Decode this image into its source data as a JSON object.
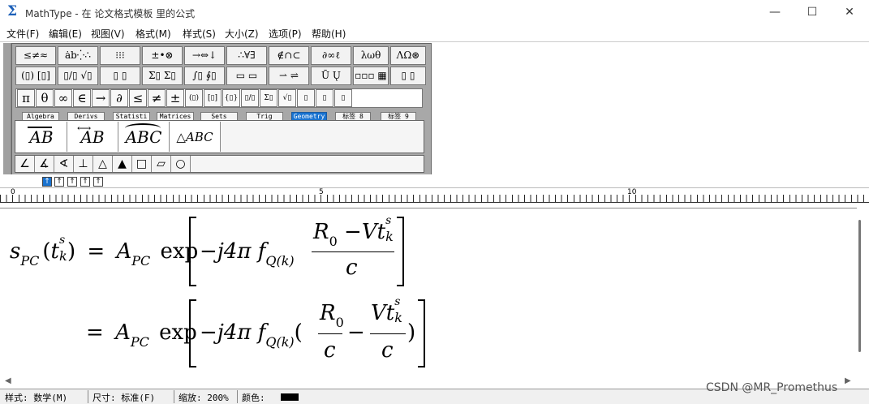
{
  "window": {
    "title": "MathType - 在 论文格式模板 里的公式",
    "min_glyph": "—",
    "max_glyph": "☐",
    "close_glyph": "✕"
  },
  "menu": [
    "文件(F)",
    "编辑(E)",
    "视图(V)",
    "格式(M)",
    "样式(S)",
    "大小(Z)",
    "选项(P)",
    "帮助(H)"
  ],
  "palette": {
    "row1": [
      "≤≠≈",
      "ȧb⁛∴",
      "⁝⁝⁝",
      "±•⊗",
      "→⇔↓",
      "∴∀∃",
      "∉∩⊂",
      "∂∞ℓ",
      "λωθ",
      "ΛΩ⊛"
    ],
    "row2": [
      "(▯) [▯]",
      "▯/▯ √▯",
      "▯ ▯",
      "Σ▯ Σ▯",
      "∫▯ ∮▯",
      "▭ ▭",
      "⇀ ⇌",
      "Ū Ų",
      "▫▫▫ ▦",
      "▯ ▯"
    ],
    "row3": [
      "π",
      "θ",
      "∞",
      "∈",
      "→",
      "∂",
      "≤",
      "≠",
      "±",
      "(▯)",
      "[▯]",
      "{▯}",
      "▯/▯",
      "Σ▯",
      "√▯",
      "▯",
      "▯",
      "▯"
    ],
    "tabs": [
      "Algebra",
      "Derivs",
      "Statisti",
      "Matrices",
      "Sets",
      "Trig",
      "Geometry",
      "标签 8",
      "标签 9"
    ],
    "active_tab": "Geometry",
    "geometry_templates": [
      "AB",
      "AB",
      "ABC",
      "△ABC"
    ],
    "shapes": [
      "∠",
      "∡",
      "∢",
      "⊥",
      "△",
      "▲",
      "□",
      "▱",
      "○"
    ]
  },
  "ruler": {
    "marks": [
      "0",
      "5",
      "10"
    ]
  },
  "equation": {
    "line1": {
      "lhs_s": "s",
      "lhs_sub": "PC",
      "lhs_t": "t",
      "lhs_t_sup": "s",
      "lhs_t_sub": "k",
      "eq": "=",
      "A": "A",
      "A_sub": "PC",
      "exp": "exp",
      "minus_j4": "−j4",
      "pi": "π",
      "f": "f",
      "f_sub": "Q(k)",
      "num_R": "R",
      "num_R_sub": "0",
      "num_minus": "−",
      "num_V": "Vt",
      "num_t_sup": "s",
      "num_t_sub": "k",
      "den": "c"
    },
    "line2": {
      "eq": "=",
      "A": "A",
      "A_sub": "PC",
      "exp": "exp",
      "minus_j4": "−j4",
      "pi": "π",
      "f": "f",
      "f_sub": "Q(k)",
      "lparen": "(",
      "f1_num_R": "R",
      "f1_num_R_sub": "0",
      "f1_den": "c",
      "minus": "−",
      "f2_num": "Vt",
      "f2_num_sup": "s",
      "f2_num_sub": "k",
      "f2_den": "c",
      "rparen": ")"
    }
  },
  "status": {
    "style": "样式: 数学(M)",
    "size": "尺寸: 标准(F)",
    "zoom": "缩放: 200%",
    "color": "颜色:",
    "color_value": "#000000"
  },
  "watermark": "CSDN @MR_Promethus"
}
